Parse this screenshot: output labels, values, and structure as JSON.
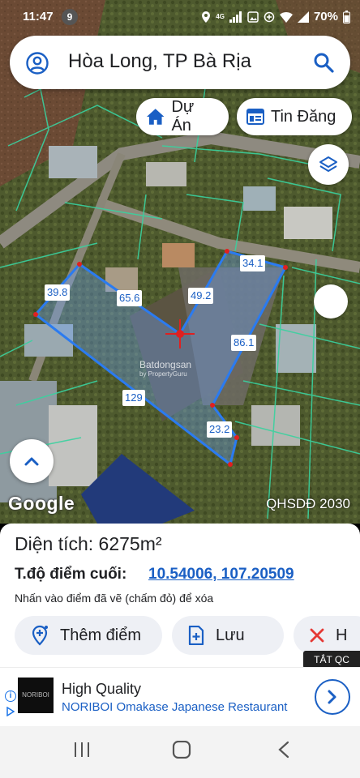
{
  "status": {
    "time": "11:47",
    "notification_count": "9",
    "network": "4G",
    "battery": "70%"
  },
  "search": {
    "query": "Hòa Long, TP Bà Rịa"
  },
  "chips": {
    "du_an": "Dự Án",
    "tin_dang": "Tin Đăng"
  },
  "map": {
    "google_label": "Google",
    "plan_label": "QHSDĐ 2030",
    "watermark": "Batdongsan",
    "watermark_sub": "by PropertyGuru",
    "dimensions": [
      "39.8",
      "65.6",
      "49.2",
      "34.1",
      "86.1",
      "129",
      "23.2"
    ]
  },
  "panel": {
    "area": "Diện tích: 6275m²",
    "coord_label": "T.độ điểm cuối:",
    "coord_value": "10.54006, 107.20509",
    "hint": "Nhấn vào điểm đã vẽ (chấm đỏ) để xóa",
    "add_point": "Thêm điểm",
    "save": "Lưu",
    "delete": "H",
    "close_ads": "TẮT QC"
  },
  "ad": {
    "logo": "NORIBOI",
    "title": "High Quality",
    "subtitle": "NORIBOI Omakase Japanese Restaurant"
  },
  "colors": {
    "accent": "#1a5fc4",
    "parcel_line": "#2b7bf0",
    "plot_line": "#3ad29f"
  }
}
